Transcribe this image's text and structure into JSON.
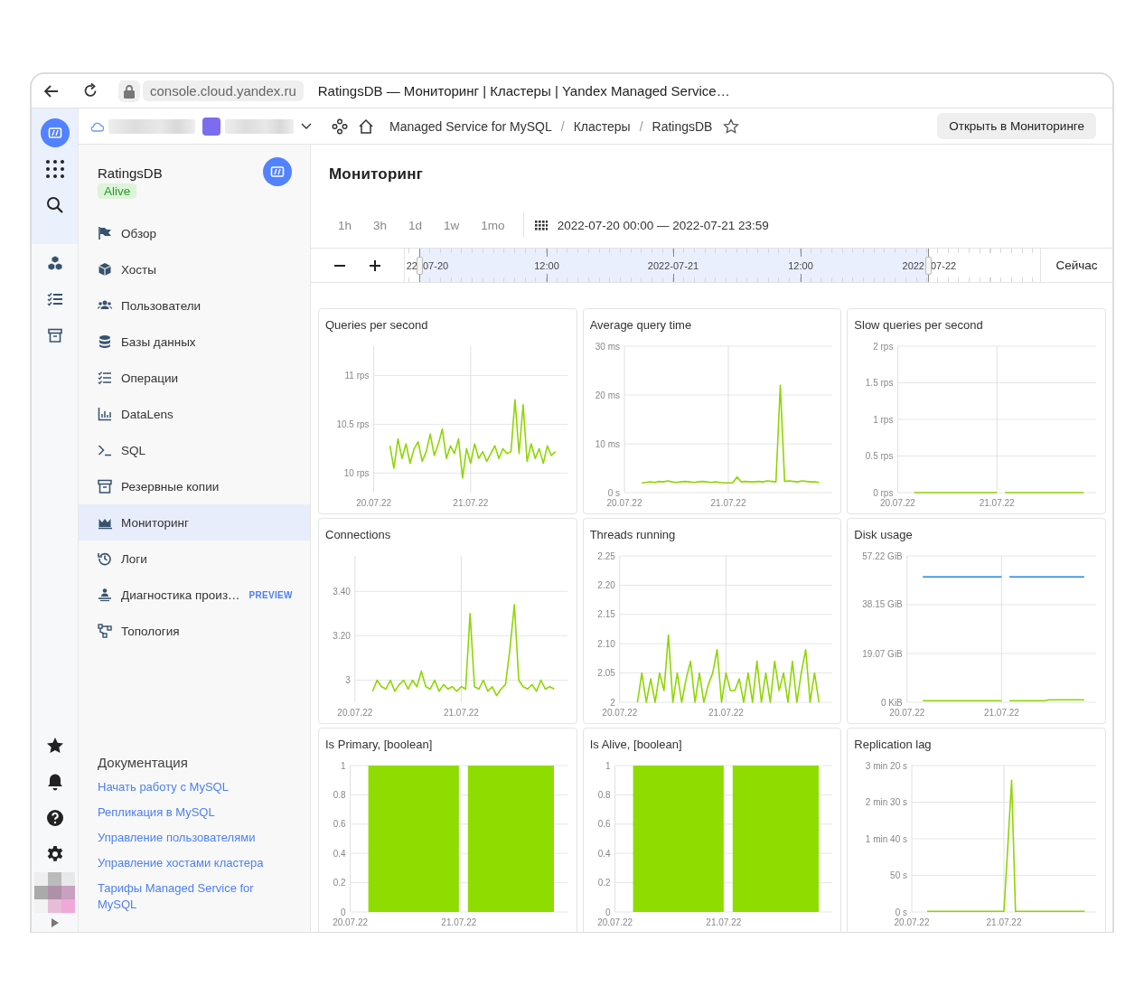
{
  "browser": {
    "url": "console.cloud.yandex.ru",
    "title": "RatingsDB — Мониторинг | Кластеры | Yandex Managed Service…"
  },
  "header": {
    "breadcrumbs": [
      {
        "label": "Managed Service for MySQL"
      },
      {
        "separator": "/",
        "label": "Кластеры"
      },
      {
        "separator": "/",
        "label": "RatingsDB"
      }
    ],
    "action": "Открыть в Мониторинге"
  },
  "cluster": {
    "name": "RatingsDB",
    "status": "Alive"
  },
  "menu": [
    {
      "label": "Обзор",
      "selected": false
    },
    {
      "label": "Хосты",
      "selected": false
    },
    {
      "label": "Пользователи",
      "selected": false
    },
    {
      "label": "Базы данных",
      "selected": false
    },
    {
      "label": "Операции",
      "selected": false
    },
    {
      "label": "DataLens",
      "selected": false
    },
    {
      "label": "SQL",
      "selected": false
    },
    {
      "label": "Резервные копии",
      "selected": false
    },
    {
      "label": "Мониторинг",
      "selected": true
    },
    {
      "label": "Логи",
      "selected": false
    },
    {
      "label": "Диагностика произ…",
      "badge": "PREVIEW",
      "selected": false
    },
    {
      "label": "Топология",
      "selected": false
    }
  ],
  "docs": {
    "title": "Документация",
    "links": [
      "Начать работу с MySQL",
      "Репликация в MySQL",
      "Управление пользователями",
      "Управление хостами кластера",
      "Тарифы Managed Service for MySQL"
    ]
  },
  "page": {
    "title": "Мониторинг"
  },
  "range": {
    "presets": [
      "1h",
      "3h",
      "1d",
      "1w",
      "1mo"
    ],
    "value": "2022-07-20 00:00 — 2022-07-21 23:59"
  },
  "timeline": {
    "labels": [
      "22",
      "07-20",
      "12:00",
      "2022-07-21",
      "12:00",
      "2022",
      "07-22"
    ],
    "now": "Сейчас"
  },
  "charts": [
    {
      "title": "Queries per second",
      "chart_data": {
        "grid": true,
        "type": "line",
        "categories": [
          "20.07.22",
          null,
          null,
          null,
          null,
          null,
          null,
          null,
          null,
          null,
          null,
          null,
          null,
          null,
          null,
          null,
          null,
          null,
          null,
          null,
          null,
          null,
          null,
          null,
          "21.07.22",
          null,
          null,
          null,
          null,
          null,
          null,
          null,
          null,
          null,
          null,
          null,
          null,
          null,
          null,
          null,
          null,
          null,
          null,
          null,
          null,
          null,
          null,
          null
        ],
        "series": [
          {
            "color": "#8ed600",
            "values": [
              null,
              null,
              null,
              null,
              10.28,
              10.05,
              10.35,
              10.15,
              10.3,
              10.1,
              10.25,
              10.32,
              10.12,
              10.22,
              10.4,
              10.18,
              10.3,
              10.45,
              10.15,
              10.28,
              10.2,
              10.35,
              9.95,
              10.25,
              10.1,
              10.3,
              10.15,
              10.22,
              10.12,
              10.2,
              10.28,
              10.15,
              10.25,
              10.2,
              10.22,
              10.75,
              10.2,
              10.7,
              10.12,
              10.3,
              10.15,
              10.25,
              10.1,
              10.28,
              10.18,
              10.22,
              null,
              null
            ]
          }
        ],
        "ylim": [
          9.8,
          11.3
        ],
        "yticks": [
          {
            "value": 10,
            "label": "10 rps"
          },
          {
            "value": 10.5,
            "label": "10.5 rps"
          },
          {
            "value": 11,
            "label": "11 rps"
          }
        ]
      }
    },
    {
      "title": "Average query time",
      "chart_data": {
        "grid": true,
        "type": "line",
        "categories": [
          "20.07.22",
          null,
          null,
          null,
          null,
          null,
          null,
          null,
          null,
          null,
          null,
          null,
          null,
          null,
          null,
          null,
          null,
          null,
          null,
          null,
          null,
          null,
          null,
          null,
          "21.07.22",
          null,
          null,
          null,
          null,
          null,
          null,
          null,
          null,
          null,
          null,
          null,
          null,
          null,
          null,
          null,
          null,
          null,
          null,
          null,
          null,
          null,
          null,
          null
        ],
        "series": [
          {
            "color": "#8ed600",
            "values": [
              null,
              null,
              null,
              null,
              2,
              2.1,
              2.2,
              2.1,
              2.3,
              2.2,
              2.4,
              2.2,
              2.1,
              2.2,
              2.3,
              2.2,
              2.1,
              2.2,
              2.3,
              2.2,
              2.1,
              2.2,
              2.1,
              2,
              2,
              2,
              3.2,
              2.2,
              2.3,
              2.2,
              2.2,
              2.3,
              2.2,
              2.4,
              2.3,
              2.2,
              22,
              2.3,
              2.4,
              2.3,
              2.2,
              2.4,
              2.3,
              2.2,
              2.2,
              2.1,
              null,
              null
            ]
          }
        ],
        "ylim": [
          0,
          30
        ],
        "yticks": [
          {
            "value": 0,
            "label": "0 s"
          },
          {
            "value": 10,
            "label": "10 ms"
          },
          {
            "value": 20,
            "label": "20 ms"
          },
          {
            "value": 30,
            "label": "30 ms"
          }
        ]
      }
    },
    {
      "title": "Slow queries per second",
      "chart_data": {
        "grid": true,
        "type": "line",
        "categories": [
          "20.07.22",
          null,
          null,
          null,
          null,
          null,
          null,
          null,
          null,
          null,
          null,
          null,
          null,
          null,
          null,
          null,
          null,
          null,
          null,
          null,
          null,
          null,
          null,
          null,
          "21.07.22",
          null,
          null,
          null,
          null,
          null,
          null,
          null,
          null,
          null,
          null,
          null,
          null,
          null,
          null,
          null,
          null,
          null,
          null,
          null,
          null,
          null,
          null,
          null
        ],
        "series": [
          {
            "color": "#8ed600",
            "values": [
              null,
              null,
              null,
              null,
              0,
              0,
              0,
              0,
              0,
              0,
              0,
              0,
              0,
              0,
              0,
              0,
              0,
              0,
              0,
              0,
              0,
              0,
              0,
              0,
              0,
              null,
              0,
              0,
              0,
              0,
              0,
              0,
              0,
              0,
              0,
              0,
              0,
              0,
              0,
              0,
              0,
              0,
              0,
              0,
              0,
              0,
              null,
              null
            ]
          }
        ],
        "ylim": [
          0,
          2
        ],
        "yticks": [
          {
            "value": 0,
            "label": "0 rps"
          },
          {
            "value": 0.5,
            "label": "0.5 rps"
          },
          {
            "value": 1,
            "label": "1 rps"
          },
          {
            "value": 1.5,
            "label": "1.5 rps"
          },
          {
            "value": 2,
            "label": "2 rps"
          }
        ]
      }
    },
    {
      "title": "Connections",
      "chart_data": {
        "grid": true,
        "type": "line",
        "categories": [
          "20.07.22",
          null,
          null,
          null,
          null,
          null,
          null,
          null,
          null,
          null,
          null,
          null,
          null,
          null,
          null,
          null,
          null,
          null,
          null,
          null,
          null,
          null,
          null,
          null,
          "21.07.22",
          null,
          null,
          null,
          null,
          null,
          null,
          null,
          null,
          null,
          null,
          null,
          null,
          null,
          null,
          null,
          null,
          null,
          null,
          null,
          null,
          null,
          null,
          null
        ],
        "series": [
          {
            "color": "#8ed600",
            "values": [
              null,
              null,
              null,
              null,
              2.95,
              3,
              2.97,
              2.96,
              3,
              2.95,
              2.98,
              3,
              2.96,
              3,
              2.97,
              3.04,
              2.97,
              2.96,
              3,
              2.95,
              2.98,
              2.96,
              2.97,
              2.95,
              2.97,
              2.96,
              3.3,
              2.97,
              2.96,
              3,
              2.95,
              2.97,
              2.93,
              2.96,
              2.98,
              3.14,
              3.34,
              3,
              2.97,
              2.96,
              2.98,
              2.95,
              3,
              2.96,
              2.97,
              2.96,
              null,
              null
            ]
          }
        ],
        "ylim": [
          2.9,
          3.56
        ],
        "yticks": [
          {
            "value": 3,
            "label": "3"
          },
          {
            "value": 3.2,
            "label": "3.20"
          },
          {
            "value": 3.4,
            "label": "3.40"
          }
        ]
      }
    },
    {
      "title": "Threads running",
      "chart_data": {
        "grid": true,
        "type": "line",
        "categories": [
          "20.07.22",
          null,
          null,
          null,
          null,
          null,
          null,
          null,
          null,
          null,
          null,
          null,
          null,
          null,
          null,
          null,
          null,
          null,
          null,
          null,
          null,
          null,
          null,
          null,
          "21.07.22",
          null,
          null,
          null,
          null,
          null,
          null,
          null,
          null,
          null,
          null,
          null,
          null,
          null,
          null,
          null,
          null,
          null,
          null,
          null,
          null,
          null,
          null,
          null
        ],
        "series": [
          {
            "color": "#8ed600",
            "values": [
              null,
              null,
              null,
              null,
              2,
              2.05,
              2,
              2.04,
              2,
              2.05,
              2.02,
              2.115,
              2,
              2.05,
              2,
              2.04,
              2.07,
              2,
              2.05,
              2,
              2.03,
              2.05,
              2.09,
              2,
              2.05,
              2.02,
              2.02,
              2.04,
              2,
              2.05,
              2,
              2.07,
              2,
              2.05,
              2,
              2.07,
              2.02,
              2.05,
              2,
              2.07,
              2,
              2.05,
              2.09,
              2,
              2.05,
              2,
              null,
              null
            ]
          }
        ],
        "ylim": [
          2,
          2.25
        ],
        "yticks": [
          {
            "value": 2,
            "label": "2"
          },
          {
            "value": 2.05,
            "label": "2.05"
          },
          {
            "value": 2.1,
            "label": "2.10"
          },
          {
            "value": 2.15,
            "label": "2.15"
          },
          {
            "value": 2.2,
            "label": "2.20"
          },
          {
            "value": 2.25,
            "label": "2.25"
          }
        ]
      }
    },
    {
      "title": "Disk usage",
      "chart_data": {
        "grid": true,
        "type": "line",
        "categories": [
          "20.07.22",
          null,
          null,
          null,
          null,
          null,
          null,
          null,
          null,
          null,
          null,
          null,
          null,
          null,
          null,
          null,
          null,
          null,
          null,
          null,
          null,
          null,
          null,
          null,
          "21.07.22",
          null,
          null,
          null,
          null,
          null,
          null,
          null,
          null,
          null,
          null,
          null,
          null,
          null,
          null,
          null,
          null,
          null,
          null,
          null,
          null,
          null,
          null,
          null
        ],
        "series": [
          {
            "color": "#1e88e5",
            "values": [
              null,
              null,
              null,
              null,
              49,
              49,
              49,
              49,
              49,
              49,
              49,
              49,
              49,
              49,
              49,
              49,
              49,
              49,
              49,
              49,
              49,
              49,
              49,
              49,
              49,
              null,
              49,
              49,
              49,
              49,
              49,
              49,
              49,
              49,
              49,
              49,
              49,
              49,
              49,
              49,
              49,
              49,
              49,
              49,
              49,
              49,
              null,
              null
            ]
          },
          {
            "color": "#8ed600",
            "values": [
              null,
              null,
              null,
              null,
              0.6,
              0.6,
              0.6,
              0.6,
              0.6,
              0.6,
              0.6,
              0.6,
              0.6,
              0.6,
              0.6,
              0.6,
              0.6,
              0.6,
              0.6,
              0.6,
              0.6,
              0.6,
              0.6,
              0.6,
              0.6,
              null,
              0.6,
              0.6,
              0.6,
              0.6,
              0.6,
              0.6,
              0.6,
              0.6,
              0.6,
              0.6,
              1,
              1,
              1,
              1,
              1,
              1,
              1,
              1,
              1,
              1,
              null,
              null
            ]
          }
        ],
        "ylim": [
          0,
          57.22
        ],
        "yticks": [
          {
            "value": 0,
            "label": "0 KiB"
          },
          {
            "value": 19.07,
            "label": "19.07 GiB"
          },
          {
            "value": 38.15,
            "label": "38.15 GiB"
          },
          {
            "value": 57.22,
            "label": "57.22 GiB"
          }
        ]
      }
    },
    {
      "title": "Is Primary, [boolean]",
      "chart_data": {
        "grid": true,
        "type": "area",
        "categories": [
          "20.07.22",
          null,
          null,
          null,
          null,
          null,
          null,
          null,
          null,
          null,
          null,
          null,
          null,
          null,
          null,
          null,
          null,
          null,
          null,
          null,
          null,
          null,
          null,
          null,
          "21.07.22",
          null,
          null,
          null,
          null,
          null,
          null,
          null,
          null,
          null,
          null,
          null,
          null,
          null,
          null,
          null,
          null,
          null,
          null,
          null,
          null,
          null,
          null,
          null
        ],
        "series": [
          {
            "color": "#8fdc00",
            "values": [
              null,
              null,
              null,
              null,
              1,
              1,
              1,
              1,
              1,
              1,
              1,
              1,
              1,
              1,
              1,
              1,
              1,
              1,
              1,
              1,
              1,
              1,
              1,
              1,
              1,
              null,
              1,
              1,
              1,
              1,
              1,
              1,
              1,
              1,
              1,
              1,
              1,
              1,
              1,
              1,
              1,
              1,
              1,
              1,
              1,
              1,
              null,
              null
            ]
          }
        ],
        "ylim": [
          0,
          1
        ],
        "yticks": [
          {
            "value": 0,
            "label": "0"
          },
          {
            "value": 0.2,
            "label": "0.2"
          },
          {
            "value": 0.4,
            "label": "0.4"
          },
          {
            "value": 0.6,
            "label": "0.6"
          },
          {
            "value": 0.8,
            "label": "0.8"
          },
          {
            "value": 1,
            "label": "1"
          }
        ]
      }
    },
    {
      "title": "Is Alive, [boolean]",
      "chart_data": {
        "grid": true,
        "type": "area",
        "categories": [
          "20.07.22",
          null,
          null,
          null,
          null,
          null,
          null,
          null,
          null,
          null,
          null,
          null,
          null,
          null,
          null,
          null,
          null,
          null,
          null,
          null,
          null,
          null,
          null,
          null,
          "21.07.22",
          null,
          null,
          null,
          null,
          null,
          null,
          null,
          null,
          null,
          null,
          null,
          null,
          null,
          null,
          null,
          null,
          null,
          null,
          null,
          null,
          null,
          null,
          null
        ],
        "series": [
          {
            "color": "#8fdc00",
            "values": [
              null,
              null,
              null,
              null,
              1,
              1,
              1,
              1,
              1,
              1,
              1,
              1,
              1,
              1,
              1,
              1,
              1,
              1,
              1,
              1,
              1,
              1,
              1,
              1,
              1,
              null,
              1,
              1,
              1,
              1,
              1,
              1,
              1,
              1,
              1,
              1,
              1,
              1,
              1,
              1,
              1,
              1,
              1,
              1,
              1,
              1,
              null,
              null
            ]
          }
        ],
        "ylim": [
          0,
          1
        ],
        "yticks": [
          {
            "value": 0,
            "label": "0"
          },
          {
            "value": 0.2,
            "label": "0.2"
          },
          {
            "value": 0.4,
            "label": "0.4"
          },
          {
            "value": 0.6,
            "label": "0.6"
          },
          {
            "value": 0.8,
            "label": "0.8"
          },
          {
            "value": 1,
            "label": "1"
          }
        ]
      }
    },
    {
      "title": "Replication lag",
      "chart_data": {
        "grid": true,
        "type": "line",
        "categories": [
          "20.07.22",
          null,
          null,
          null,
          null,
          null,
          null,
          null,
          null,
          null,
          null,
          null,
          null,
          null,
          null,
          null,
          null,
          null,
          null,
          null,
          null,
          null,
          null,
          null,
          "21.07.22",
          null,
          null,
          null,
          null,
          null,
          null,
          null,
          null,
          null,
          null,
          null,
          null,
          null,
          null,
          null,
          null,
          null,
          null,
          null,
          null,
          null,
          null,
          null
        ],
        "series": [
          {
            "color": "#8ed600",
            "values": [
              null,
              null,
              null,
              null,
              1,
              1,
              1,
              1,
              1,
              1,
              1,
              1,
              1,
              1,
              1,
              1,
              1,
              1,
              1,
              1,
              1,
              1,
              1,
              1,
              1,
              90,
              180,
              1,
              1,
              1,
              1,
              1,
              1,
              1,
              1,
              1,
              1,
              1,
              1,
              1,
              1,
              1,
              1,
              1,
              1,
              1,
              null,
              null
            ]
          }
        ],
        "ylim": [
          0,
          200
        ],
        "yticks": [
          {
            "value": 0,
            "label": "0 s"
          },
          {
            "value": 50,
            "label": "50 s"
          },
          {
            "value": 100,
            "label": "1 min 40 s"
          },
          {
            "value": 150,
            "label": "2 min 30 s"
          },
          {
            "value": 200,
            "label": "3 min 20 s"
          }
        ]
      }
    }
  ]
}
